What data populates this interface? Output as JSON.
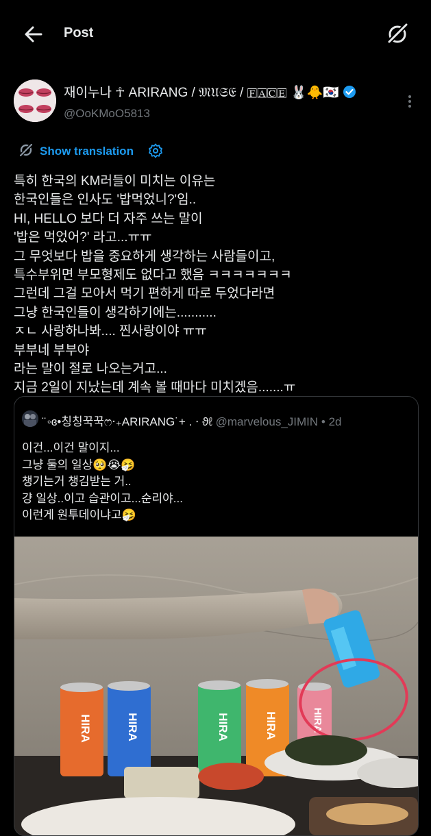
{
  "header": {
    "title": "Post"
  },
  "tweet": {
    "display_name": "재이누나 ☥ ARIRANG / 𝔐𝔘𝔖𝔈 / 🄵🄰🄲🄴 🐰🐥🇰🇷",
    "handle": "@OoKMoO5813",
    "translate_label": "Show translation",
    "body_lines": [
      "특히 한국의 KM러들이 미치는 이유는",
      "한국인들은 인사도 '밥먹었니?'임..",
      "HI, HELLO 보다 더 자주 쓰는 말이",
      "'밥은 먹었어?' 라고...ㅠㅠ",
      "그 무엇보다 밥을 중요하게 생각하는 사람들이고,",
      "특수부위면 부모형제도 없다고 했음 ㅋㅋㅋㅋㅋㅋㅋ",
      "그런데 그걸 모아서 먹기 편하게 따로 두었다라면",
      "그냥 한국인들이 생각하기에는...........",
      "ㅈㄴ 사랑하나봐.... 찐사랑이야 ㅠㅠ",
      "부부네 부부야",
      "라는 말이 절로 나오는거고...",
      "지금 2일이 지났는데 계속 볼 때마다 미치겠음.......ㅠ"
    ]
  },
  "quoted": {
    "display_name": "̈ ◦ɞ•칭칭꾹꾹ෆ‧₊ARIRANG˙+ . ⋅ ϑℓ",
    "handle": "@marvelous_JIMIN",
    "time": "2d",
    "body_lines": [
      "이건...이건 말이지...",
      "그냥 둘의 일상🥺😭🤧",
      "챙기는거 챙김받는 거..",
      "걍 일상..이고 습관이고...순리야...",
      "이런게 원투데이냐고🤧"
    ],
    "cans": [
      "HIRA",
      "HIRA",
      "HIRA",
      "HIRA",
      "HIRA"
    ]
  },
  "colors": {
    "accent": "#1d9bf0",
    "secondary_text": "#71767b",
    "border": "#333639"
  }
}
